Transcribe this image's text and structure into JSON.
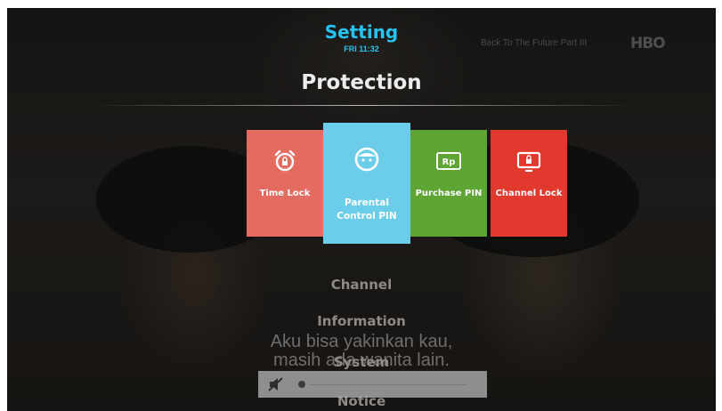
{
  "header": {
    "title": "Setting",
    "time": "FRI 11:32",
    "now_playing": "Back To The Future Part III",
    "channel_logo": "HBO"
  },
  "section": {
    "title": "Protection"
  },
  "tiles": [
    {
      "label": "Time Lock",
      "icon": "alarm-clock-lock-icon",
      "color": "#e46b5f"
    },
    {
      "label_line1": "Parental",
      "label_line2": "Control PIN",
      "icon": "child-face-icon",
      "color": "#6ccdeb",
      "selected": true
    },
    {
      "label": "Purchase PIN",
      "icon": "rp-currency-icon",
      "color": "#5ea534",
      "icon_text": "Rp"
    },
    {
      "label": "Channel Lock",
      "icon": "tv-lock-icon",
      "color": "#e2392e"
    }
  ],
  "menu": {
    "items": [
      "Channel",
      "Information",
      "System",
      "Notice"
    ]
  },
  "subtitle": {
    "line1": "Aku bisa yakinkan kau,",
    "line2": "masih ada wanita lain."
  },
  "volume": {
    "icon": "mute-speaker-icon",
    "level": 0
  }
}
